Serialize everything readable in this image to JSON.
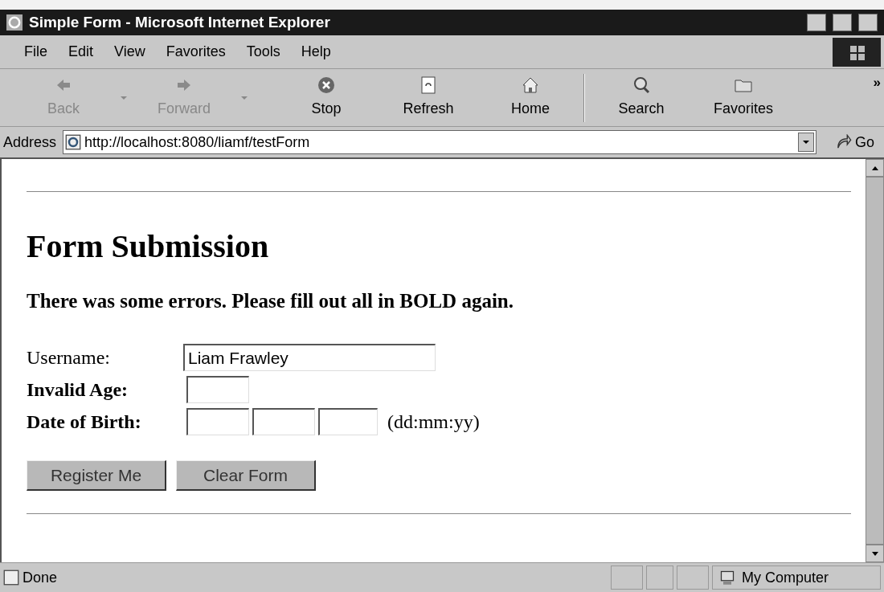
{
  "window": {
    "title": "Simple Form - Microsoft Internet Explorer"
  },
  "menu": [
    "File",
    "Edit",
    "View",
    "Favorites",
    "Tools",
    "Help"
  ],
  "toolbar": [
    {
      "label": "Back",
      "kind": "back",
      "disabled": true,
      "dropdown": true
    },
    {
      "label": "Forward",
      "kind": "forward",
      "disabled": true,
      "dropdown": true
    },
    {
      "label": "Stop",
      "kind": "stop",
      "disabled": false,
      "dropdown": false
    },
    {
      "label": "Refresh",
      "kind": "refresh",
      "disabled": false,
      "dropdown": false
    },
    {
      "label": "Home",
      "kind": "home",
      "disabled": false,
      "dropdown": false
    },
    {
      "label": "Search",
      "kind": "search",
      "disabled": false,
      "dropdown": false
    },
    {
      "label": "Favorites",
      "kind": "favorites",
      "disabled": false,
      "dropdown": false
    }
  ],
  "toolbar_more": "»",
  "address": {
    "label": "Address",
    "url": "http://localhost:8080/liamf/testForm",
    "go": "Go"
  },
  "page": {
    "heading": "Form Submission",
    "error": "There was some errors. Please fill out all in BOLD again.",
    "fields": [
      {
        "label": "Username:",
        "kind": "text",
        "bold": false,
        "value": "Liam Frawley"
      },
      {
        "label": "Invalid Age:",
        "kind": "short",
        "bold": true
      },
      {
        "label": "Date of Birth:",
        "kind": "date",
        "bold": true,
        "hint": "(dd:mm:yy)"
      }
    ],
    "buttons": [
      "Register Me",
      "Clear Form"
    ]
  },
  "status_bar": {
    "text": "Done",
    "zone": "My Computer"
  }
}
